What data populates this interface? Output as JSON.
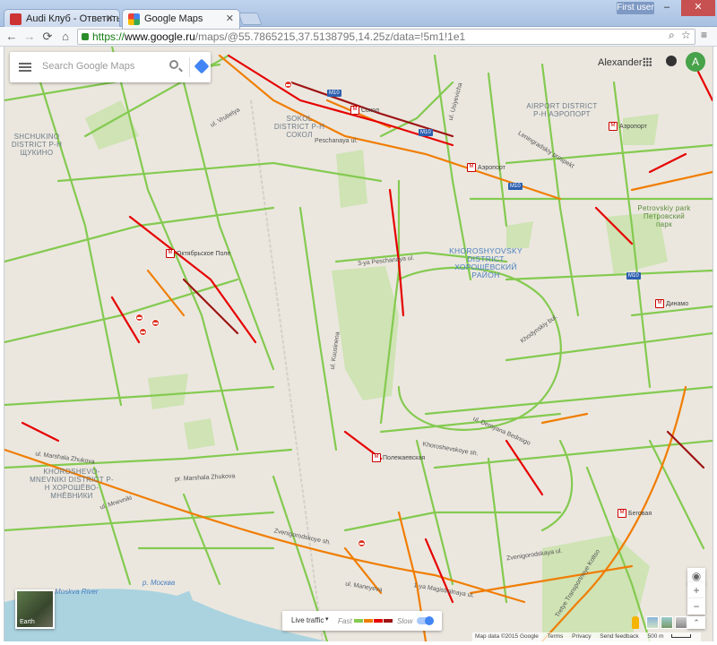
{
  "browser": {
    "tabs": [
      {
        "label": "Audi Клуб - Ответить в те...",
        "close": "✕",
        "active": false
      },
      {
        "label": "Google Maps",
        "close": "✕",
        "active": true
      }
    ],
    "user_badge": "First user",
    "window_controls": {
      "minimize": "–",
      "maximize": "□",
      "close": "✕"
    },
    "nav": {
      "back": "←",
      "forward": "→",
      "reload": "⟳",
      "home": "⌂"
    },
    "url": {
      "scheme": "https://",
      "host": "www.google.ru",
      "path": "/maps/@55.7865215,37.5138795,14.25z/data=!5m1!1e1"
    },
    "omnibox_icons": {
      "search": "⌕",
      "star": "☆",
      "menu": "≡"
    }
  },
  "maps": {
    "search_placeholder": "Search Google Maps",
    "account_name": "Alexander",
    "avatar_letter": "A",
    "layer_button": "Earth",
    "traffic": {
      "label": "Live traffic",
      "fast_label": "Fast",
      "slow_label": "Slow",
      "legend_colors": [
        "#84ca50",
        "#f07d02",
        "#e60000",
        "#9e1313"
      ],
      "toggle_on": true
    },
    "zoom": {
      "in": "+",
      "out": "−",
      "locate": "◉",
      "expand": "⌃"
    },
    "footer": {
      "data": "Map data ©2015 Google",
      "terms": "Terms",
      "privacy": "Privacy",
      "feedback": "Send feedback",
      "scale": "500 m"
    },
    "districts": [
      {
        "text": "SHCHUKINO DISTRICT Р-Н ЩУКИНО"
      },
      {
        "text": "SOKOL DISTRICT Р-Н СОКОЛ"
      },
      {
        "text": "AIRPORT DISTRICT Р-Н АЭРОПОРТ"
      },
      {
        "text": "KHOROSHYOVSKY DISTRICT ХОРОШЁВСКИЙ РАЙОН"
      },
      {
        "text": "KHOROSHEVO-MNEVNIKI DISTRICT Р-Н ХОРОШЁВО-МНЁВНИКИ"
      },
      {
        "text": "Petrovskiy park Петровский парк"
      }
    ],
    "streets": [
      "ul. Vrubelya",
      "Peschanaya ul.",
      "3-ya Peschanaya ul.",
      "ul. Usiyevicha",
      "Leningradskiy prospekt",
      "ul. Marshala Zhukova",
      "pr. Marshala Zhukova",
      "Zvenigorodskoye sh.",
      "ul. Mnevniki",
      "Khoroshevskoye sh.",
      "ul. Demyana Bednogo",
      "ul. Kuusinena",
      "Zvenigorodskaya ul.",
      "Khodynskiy bul.",
      "1-ya Magistralnaya ul.",
      "Tretye Transportnoye Koltso",
      "ul. Maneyeva"
    ],
    "metro": [
      "Сокол",
      "Аэропорт",
      "Октябрьское Поле",
      "Полежаевская",
      "Беговая",
      "Динамо",
      "Аэропорт"
    ],
    "highway_shields": [
      "M10",
      "M10",
      "M10",
      "M10"
    ],
    "river": "р. Москва",
    "river_en": "Moskva River"
  }
}
